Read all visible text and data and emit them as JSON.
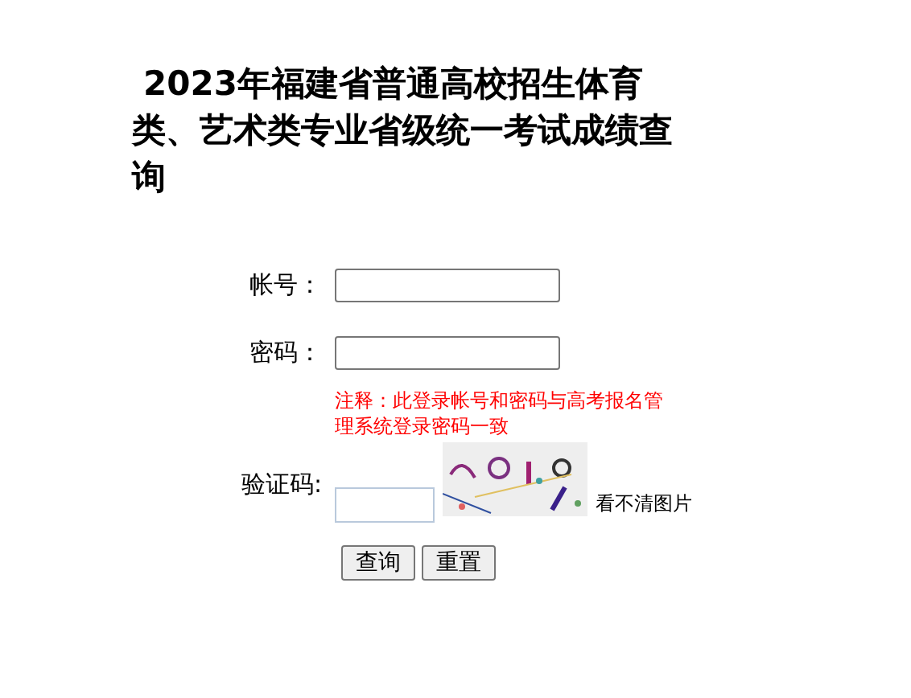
{
  "title": "2023年福建省普通高校招生体育类、艺术类专业省级统一考试成绩查询",
  "fields": [
    {
      "label": "帐号："
    },
    {
      "label": "密码："
    }
  ],
  "note": "注释：此登录帐号和密码与高考报名管理系统登录密码一致",
  "captcha": {
    "label": "验证码:",
    "refresh_link": "看不清图片"
  },
  "buttons": [
    "查询",
    "重置"
  ]
}
